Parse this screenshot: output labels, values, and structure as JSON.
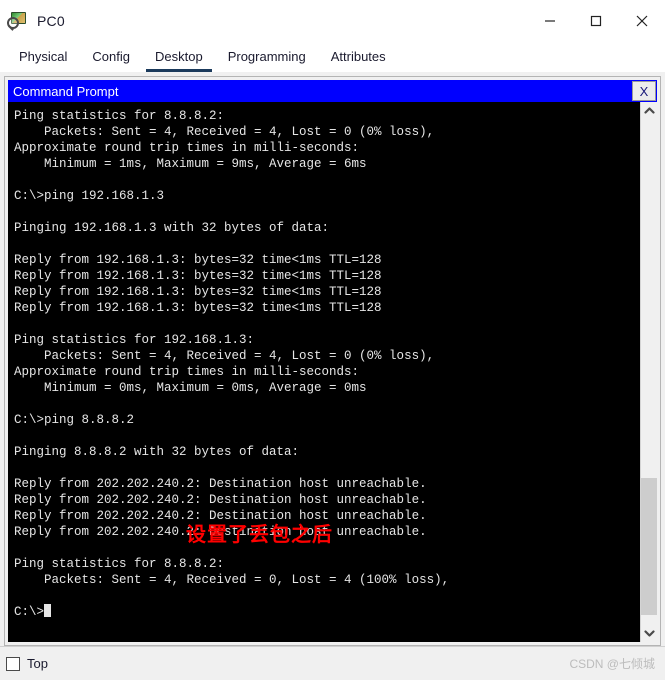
{
  "window": {
    "title": "PC0",
    "icon": "pc-magnifier-icon",
    "controls": {
      "minimize": "minimize-icon",
      "maximize": "maximize-icon",
      "close": "close-icon"
    }
  },
  "tabs": [
    {
      "label": "Physical",
      "active": false
    },
    {
      "label": "Config",
      "active": false
    },
    {
      "label": "Desktop",
      "active": true
    },
    {
      "label": "Programming",
      "active": false
    },
    {
      "label": "Attributes",
      "active": false
    }
  ],
  "command_prompt": {
    "title": "Command Prompt",
    "close_label": "X",
    "colors": {
      "titlebar_bg": "#0000ff",
      "titlebar_fg": "#ffffff",
      "terminal_bg": "#000000",
      "terminal_fg": "#e6e6e6",
      "annotation": "#ff0000"
    },
    "lines": [
      "Ping statistics for 8.8.8.2:",
      "    Packets: Sent = 4, Received = 4, Lost = 0 (0% loss),",
      "Approximate round trip times in milli-seconds:",
      "    Minimum = 1ms, Maximum = 9ms, Average = 6ms",
      "",
      "C:\\>ping 192.168.1.3",
      "",
      "Pinging 192.168.1.3 with 32 bytes of data:",
      "",
      "Reply from 192.168.1.3: bytes=32 time<1ms TTL=128",
      "Reply from 192.168.1.3: bytes=32 time<1ms TTL=128",
      "Reply from 192.168.1.3: bytes=32 time<1ms TTL=128",
      "Reply from 192.168.1.3: bytes=32 time<1ms TTL=128",
      "",
      "Ping statistics for 192.168.1.3:",
      "    Packets: Sent = 4, Received = 4, Lost = 0 (0% loss),",
      "Approximate round trip times in milli-seconds:",
      "    Minimum = 0ms, Maximum = 0ms, Average = 0ms",
      "",
      "C:\\>ping 8.8.8.2",
      "",
      "Pinging 8.8.8.2 with 32 bytes of data:",
      "",
      "Reply from 202.202.240.2: Destination host unreachable.",
      "Reply from 202.202.240.2: Destination host unreachable.",
      "Reply from 202.202.240.2: Destination host unreachable.",
      "Reply from 202.202.240.2: Destination host unreachable.",
      "",
      "Ping statistics for 8.8.8.2:",
      "    Packets: Sent = 4, Received = 0, Lost = 4 (100% loss),",
      "",
      "C:\\>"
    ],
    "annotation": "设置了丢包之后",
    "scrollbar": {
      "up_arrow": "chevron-up-icon",
      "down_arrow": "chevron-down-icon"
    }
  },
  "bottom": {
    "top_checkbox_label": "Top",
    "top_checkbox_checked": false,
    "watermark": "CSDN @七倾城"
  }
}
